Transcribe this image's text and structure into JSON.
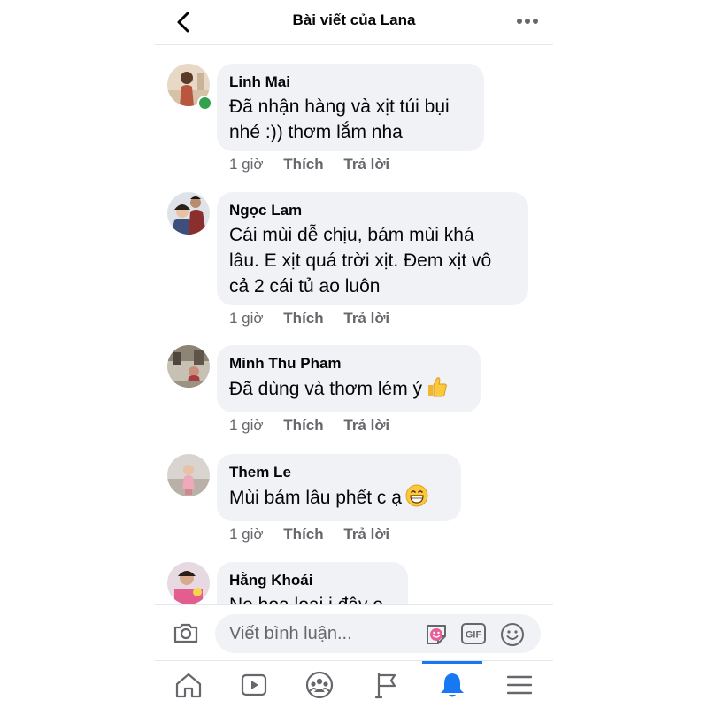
{
  "header": {
    "title": "Bài viết của Lana",
    "back_icon": "chevron-left-icon",
    "more_icon": "more-horizontal-icon"
  },
  "comments": [
    {
      "author": "Linh Mai",
      "text_lines": [
        "Đã nhận hàng và xịt túi bụi",
        "nhé :)) thơm lắm nha"
      ],
      "time": "1 giờ",
      "like_label": "Thích",
      "reply_label": "Trả lời",
      "online": true
    },
    {
      "author": "Ngọc Lam",
      "text_lines": [
        "Cái mùi  dễ  chịu, bám mùi khá",
        "lâu. E xịt quá trời  xịt. Đem xịt vô",
        "cả 2 cái tủ ao luôn"
      ],
      "time": "1 giờ",
      "like_label": "Thích",
      "reply_label": "Trả lời"
    },
    {
      "author": "Minh Thu Pham",
      "text_lines": [
        "Đã dùng và thơm lém ý"
      ],
      "emoji": "thumbs-up-icon",
      "time": "1 giờ",
      "like_label": "Thích",
      "reply_label": "Trả lời"
    },
    {
      "author": "Them Le",
      "text_lines": [
        "Mùi bám lâu phết c ạ"
      ],
      "emoji": "grinning-face-icon",
      "time": "1 giờ",
      "like_label": "Thích",
      "reply_label": "Trả lời"
    },
    {
      "author": "Hằng Khoái",
      "text_lines": [
        "Ne hoa loại i đây e"
      ]
    }
  ],
  "composer": {
    "placeholder": "Viết bình luận...",
    "camera_icon": "camera-icon",
    "sticker_icon": "sticker-icon",
    "gif_label": "GIF",
    "emoji_icon": "smile-icon"
  },
  "nav": {
    "items": [
      "home-icon",
      "video-icon",
      "groups-icon",
      "pages-flag-icon",
      "notifications-bell-icon",
      "menu-icon"
    ],
    "active": "notifications-bell-icon"
  },
  "colors": {
    "accent": "#1877f2",
    "bubble": "#f0f2f5",
    "secondary_text": "#65676b",
    "online": "#31a24c"
  }
}
